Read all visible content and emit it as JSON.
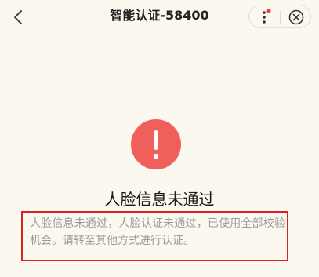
{
  "header": {
    "title": "智能认证-58400"
  },
  "icons": {
    "back": "chevron-left-icon",
    "more": "more-dots-icon",
    "close": "close-circle-icon",
    "status": "exclamation-icon"
  },
  "result": {
    "title": "人脸信息未通过",
    "description": "人脸信息未通过，人脸认证未通过，已使用全部校验机会。请转至其他方式进行认证。"
  },
  "colors": {
    "background": "#fbf8ef",
    "error": "#f0605a",
    "highlight_border": "#e02020",
    "description_text": "#9b9b9b",
    "notification_dot": "#f04040"
  }
}
